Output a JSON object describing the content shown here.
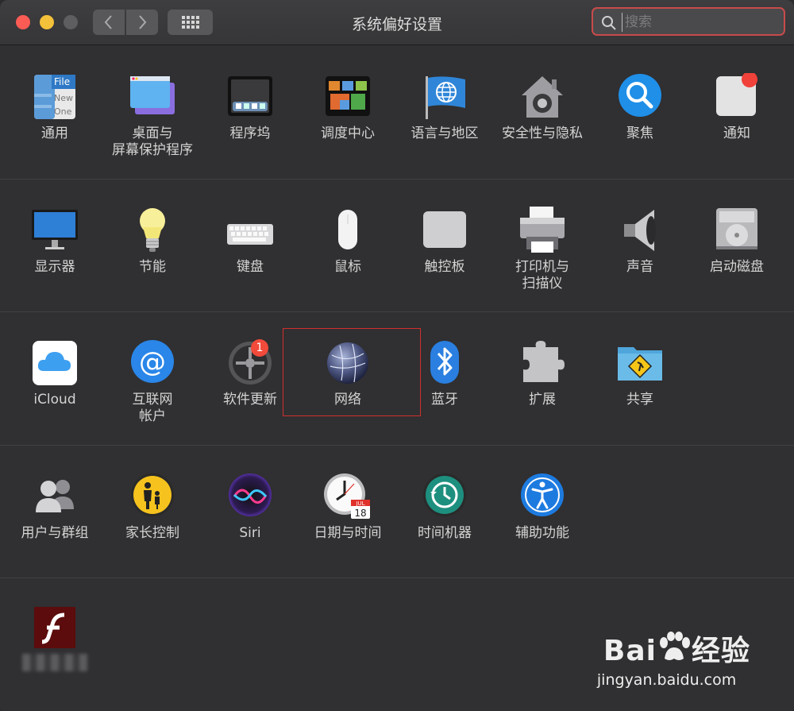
{
  "window": {
    "title": "系统偏好设置"
  },
  "search": {
    "placeholder": "搜索"
  },
  "rows": [
    [
      {
        "label": "通用",
        "icon": "general-icon"
      },
      {
        "label": "桌面与\n屏幕保护程序",
        "icon": "desktop-screensaver-icon"
      },
      {
        "label": "程序坞",
        "icon": "dock-icon"
      },
      {
        "label": "调度中心",
        "icon": "mission-control-icon"
      },
      {
        "label": "语言与地区",
        "icon": "language-region-icon"
      },
      {
        "label": "安全性与隐私",
        "icon": "security-privacy-icon"
      },
      {
        "label": "聚焦",
        "icon": "spotlight-icon"
      },
      {
        "label": "通知",
        "icon": "notifications-icon"
      }
    ],
    [
      {
        "label": "显示器",
        "icon": "displays-icon"
      },
      {
        "label": "节能",
        "icon": "energy-saver-icon"
      },
      {
        "label": "键盘",
        "icon": "keyboard-icon"
      },
      {
        "label": "鼠标",
        "icon": "mouse-icon"
      },
      {
        "label": "触控板",
        "icon": "trackpad-icon"
      },
      {
        "label": "打印机与\n扫描仪",
        "icon": "printer-scanner-icon"
      },
      {
        "label": "声音",
        "icon": "sound-icon"
      },
      {
        "label": "启动磁盘",
        "icon": "startup-disk-icon"
      }
    ],
    [
      {
        "label": "iCloud",
        "icon": "icloud-icon"
      },
      {
        "label": "互联网\n帐户",
        "icon": "internet-accounts-icon"
      },
      {
        "label": "软件更新",
        "icon": "software-update-icon",
        "badge": "1"
      },
      {
        "label": "网络",
        "icon": "network-icon"
      },
      {
        "label": "蓝牙",
        "icon": "bluetooth-icon"
      },
      {
        "label": "扩展",
        "icon": "extensions-icon"
      },
      {
        "label": "共享",
        "icon": "sharing-icon"
      }
    ],
    [
      {
        "label": "用户与群组",
        "icon": "users-groups-icon"
      },
      {
        "label": "家长控制",
        "icon": "parental-controls-icon"
      },
      {
        "label": "Siri",
        "icon": "siri-icon"
      },
      {
        "label": "日期与时间",
        "icon": "date-time-icon",
        "calendar_month": "JUL",
        "calendar_day": "18"
      },
      {
        "label": "时间机器",
        "icon": "time-machine-icon"
      },
      {
        "label": "辅助功能",
        "icon": "accessibility-icon"
      }
    ],
    [
      {
        "label": "",
        "icon": "flash-player-icon"
      }
    ]
  ],
  "icon_texts": {
    "general_line1": "File",
    "general_line2": "New",
    "general_line3": "One"
  },
  "watermark": {
    "brand": "Bai",
    "suffix": "经验",
    "url": "jingyan.baidu.com"
  },
  "colors": {
    "highlight_box": "#d1302f",
    "badge": "#f24a3b",
    "search_focus": "#c84b4b"
  }
}
